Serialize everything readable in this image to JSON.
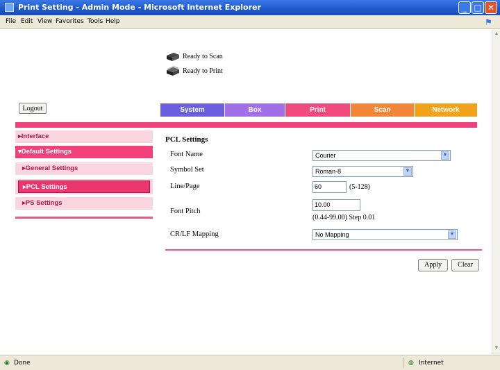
{
  "window": {
    "title": "Print Setting - Admin Mode - Microsoft Internet Explorer"
  },
  "menu": [
    {
      "label": "File"
    },
    {
      "label": "Edit"
    },
    {
      "label": "View"
    },
    {
      "label": "Favorites"
    },
    {
      "label": "Tools"
    },
    {
      "label": "Help"
    }
  ],
  "device_status": {
    "scan": "Ready to Scan",
    "print": "Ready to Print"
  },
  "logout_label": "Logout",
  "tabs": [
    {
      "label": "System",
      "color": "#6b5fe0"
    },
    {
      "label": "Box",
      "color": "#a070e8"
    },
    {
      "label": "Print",
      "color": "#f04a7e"
    },
    {
      "label": "Scan",
      "color": "#f2873a"
    },
    {
      "label": "Network",
      "color": "#f2a31b"
    }
  ],
  "nav": {
    "items": [
      {
        "label": "▸Interface"
      },
      {
        "label": "▾Default Settings"
      },
      {
        "label": "▸General Settings"
      },
      {
        "label": "▸PCL Settings"
      },
      {
        "label": "▸PS Settings"
      }
    ]
  },
  "pcl": {
    "title": "PCL Settings",
    "font_name": {
      "label": "Font Name",
      "value": "Courier"
    },
    "symbol_set": {
      "label": "Symbol Set",
      "value": "Roman-8"
    },
    "line_page": {
      "label": "Line/Page",
      "value": "60",
      "hint": "(5-128)"
    },
    "font_pitch": {
      "label": "Font Pitch",
      "value": "10.00",
      "hint": "(0.44-99.00) Step 0.01"
    },
    "crlf": {
      "label": "CR/LF Mapping",
      "value": "No Mapping"
    }
  },
  "buttons": {
    "apply": "Apply",
    "clear": "Clear"
  },
  "status": {
    "left": "Done",
    "zone": "Internet"
  }
}
